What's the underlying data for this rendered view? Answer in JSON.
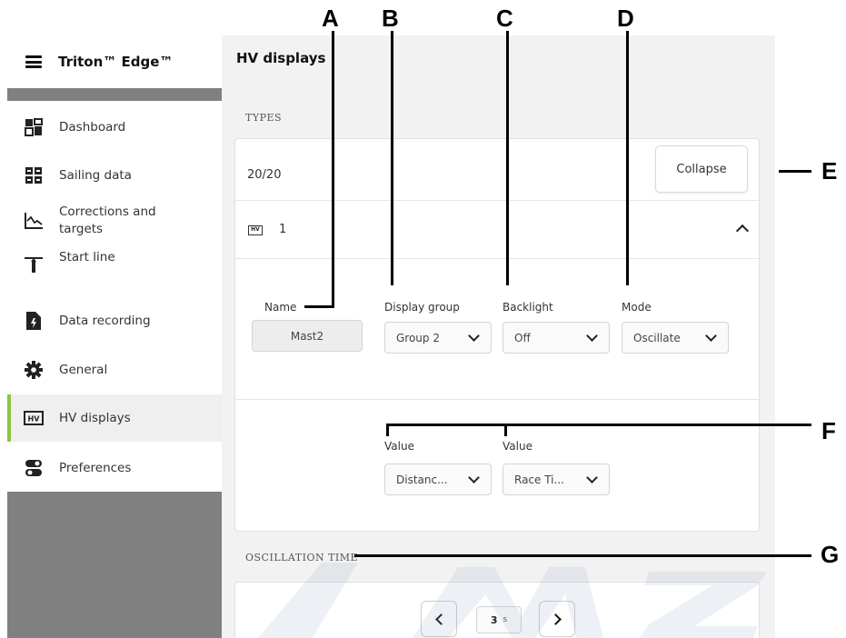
{
  "callouts": {
    "a": "A",
    "b": "B",
    "c": "C",
    "d": "D",
    "e": "E",
    "f": "F",
    "g": "G"
  },
  "app": {
    "title": "Triton™ Edge™",
    "menu_icon": "hamburger-menu-icon"
  },
  "sidebar": {
    "items": [
      {
        "label": "Dashboard",
        "icon": "dashboard-icon"
      },
      {
        "label": "Sailing data",
        "icon": "sailing-data-grid-icon"
      },
      {
        "label": "Corrections and targets",
        "icon": "corrections-graph-icon"
      },
      {
        "label": "Start line",
        "icon": "start-line-icon"
      },
      {
        "label": "Data recording",
        "icon": "data-recording-icon"
      },
      {
        "label": "General",
        "icon": "gear-icon"
      },
      {
        "label": "HV displays",
        "icon": "hv-display-icon",
        "active": true
      },
      {
        "label": "Preferences",
        "icon": "toggle-preferences-icon"
      }
    ],
    "accent_color": "#8cc63f"
  },
  "main": {
    "page_title": "HV displays",
    "types_label": "TYPES",
    "count": "20/20",
    "collapse_label": "Collapse",
    "item": {
      "badge": "HV",
      "number": "1"
    },
    "fields": {
      "name_label": "Name",
      "name_value": "Mast2",
      "display_group_label": "Display group",
      "display_group_value": "Group 2",
      "backlight_label": "Backlight",
      "backlight_value": "Off",
      "mode_label": "Mode",
      "mode_value": "Oscillate",
      "value1_label": "Value",
      "value1_value": "Distanc...",
      "value2_label": "Value",
      "value2_value": "Race Ti..."
    },
    "oscillation_label": "OSCILLATION TIME",
    "oscillation": {
      "value": "3",
      "unit": "s"
    }
  }
}
